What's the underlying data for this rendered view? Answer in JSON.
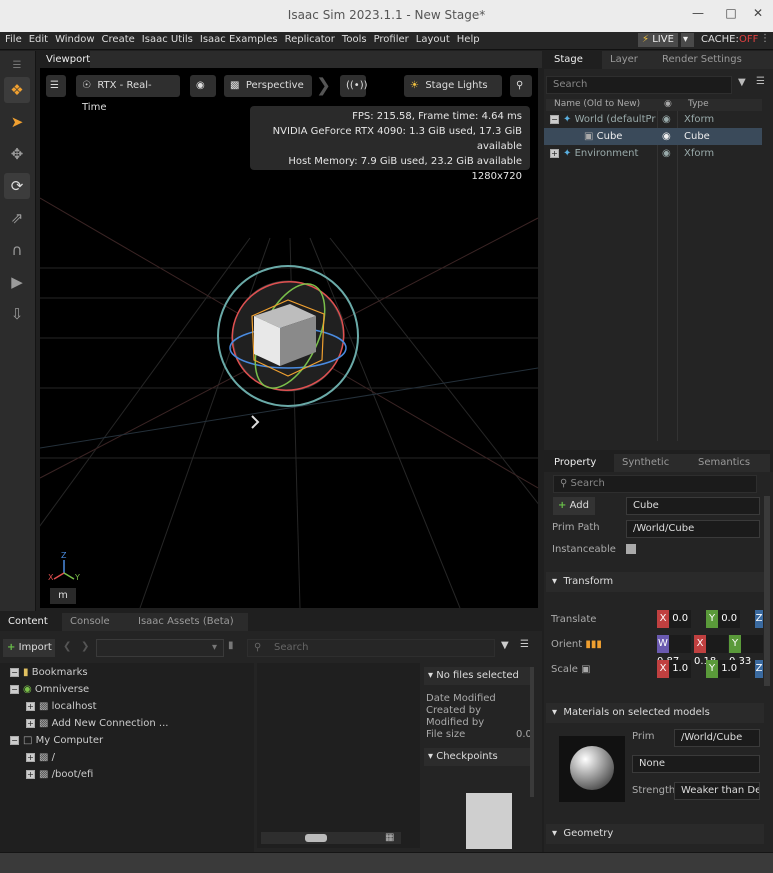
{
  "window": {
    "title": "Isaac Sim 2023.1.1 - New Stage*",
    "min_icon": "minimize-icon",
    "max_icon": "maximize-icon",
    "close_icon": "close-icon"
  },
  "menu": {
    "items": [
      "File",
      "Edit",
      "Window",
      "Create",
      "Isaac Utils",
      "Isaac Examples",
      "Replicator",
      "Tools",
      "Profiler",
      "Layout",
      "Help"
    ],
    "live": "LIVE",
    "cache_label": "CACHE:",
    "cache_state": "OFF"
  },
  "viewport": {
    "tab": "Viewport",
    "render_mode": "RTX - Real-Time",
    "camera": "Perspective",
    "lights": "Stage Lights",
    "stats": {
      "fps": "FPS: 215.58, Frame time: 4.64 ms",
      "gpu": "NVIDIA GeForce RTX 4090: 1.3 GiB used, 17.3 GiB available",
      "host": "Host Memory: 7.9 GiB used, 23.2 GiB available",
      "res": "1280x720"
    },
    "axis_z": "Z",
    "axis_x": "X",
    "axis_y": "Y",
    "units": "m",
    "accent_colors": {
      "x": "#e05050",
      "y": "#7ac04a",
      "z": "#4a8be0"
    }
  },
  "stage": {
    "tabs": [
      "Stage",
      "Layer",
      "Render Settings"
    ],
    "search_placeholder": "Search",
    "col_name": "Name (Old to New)",
    "col_type": "Type",
    "rows": [
      {
        "name": "World (defaultPr",
        "type": "Xform"
      },
      {
        "name": "Cube",
        "type": "Cube"
      },
      {
        "name": "Environment",
        "type": "Xform"
      }
    ]
  },
  "property": {
    "tabs": [
      "Property",
      "Synthetic Da...",
      "Semantics S..."
    ],
    "search_placeholder": "Search",
    "add": "Add",
    "prim_name": "Cube",
    "prim_path_label": "Prim Path",
    "prim_path": "/World/Cube",
    "instanceable_label": "Instanceable",
    "transform": "Transform",
    "translate_label": "Translate",
    "orient_label": "Orient",
    "scale_label": "Scale",
    "translate": {
      "x": "0.0",
      "y": "0.0"
    },
    "orient": {
      "w": "0.87",
      "x": "0.18",
      "y": "0.33"
    },
    "scale": {
      "x": "1.0",
      "y": "1.0"
    },
    "materials": "Materials on selected models",
    "prim_label": "Prim",
    "prim_value": "/World/Cube",
    "material": "None",
    "strength_label": "Strength",
    "strength": "Weaker than Desc",
    "geometry": "Geometry"
  },
  "content": {
    "tabs": [
      "Content",
      "Console",
      "Isaac Assets (Beta)"
    ],
    "import": "Import",
    "search_placeholder": "Search",
    "tree": [
      {
        "label": "Bookmarks"
      },
      {
        "label": "Omniverse"
      },
      {
        "label": "localhost"
      },
      {
        "label": "Add New Connection ..."
      },
      {
        "label": "My Computer"
      },
      {
        "label": "/"
      },
      {
        "label": "/boot/efi"
      }
    ],
    "info_title": "No files selected",
    "date_modified": "Date Modified",
    "created_by": "Created by",
    "modified_by": "Modified by",
    "file_size": "File size",
    "file_size_val": "0.0",
    "checkpoints": "Checkpoints"
  }
}
